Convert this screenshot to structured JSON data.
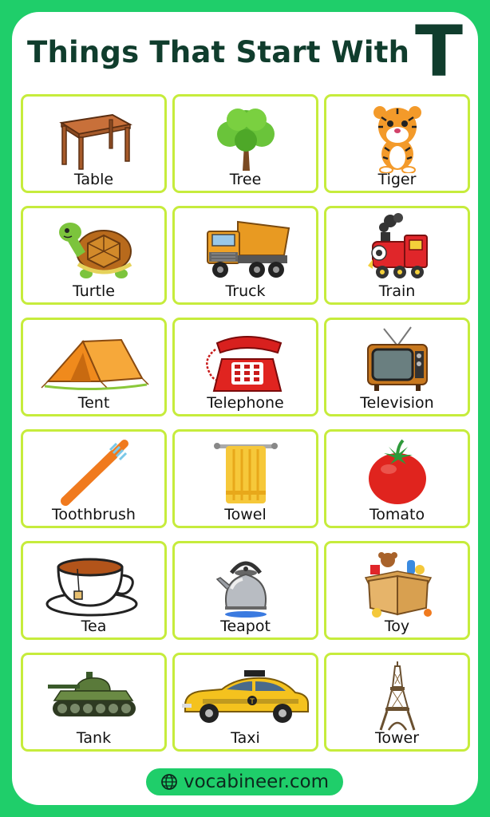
{
  "header": {
    "title": "Things That Start With",
    "letter": "T"
  },
  "cards": [
    {
      "label": "Table",
      "icon": "table-icon"
    },
    {
      "label": "Tree",
      "icon": "tree-icon"
    },
    {
      "label": "Tiger",
      "icon": "tiger-icon"
    },
    {
      "label": "Turtle",
      "icon": "turtle-icon"
    },
    {
      "label": "Truck",
      "icon": "truck-icon"
    },
    {
      "label": "Train",
      "icon": "train-icon"
    },
    {
      "label": "Tent",
      "icon": "tent-icon"
    },
    {
      "label": "Telephone",
      "icon": "telephone-icon"
    },
    {
      "label": "Television",
      "icon": "television-icon"
    },
    {
      "label": "Toothbrush",
      "icon": "toothbrush-icon"
    },
    {
      "label": "Towel",
      "icon": "towel-icon"
    },
    {
      "label": "Tomato",
      "icon": "tomato-icon"
    },
    {
      "label": "Tea",
      "icon": "tea-icon"
    },
    {
      "label": "Teapot",
      "icon": "teapot-icon"
    },
    {
      "label": "Toy",
      "icon": "toy-icon"
    },
    {
      "label": "Tank",
      "icon": "tank-icon"
    },
    {
      "label": "Taxi",
      "icon": "taxi-icon"
    },
    {
      "label": "Tower",
      "icon": "tower-icon"
    }
  ],
  "footer": {
    "site": "vocabineer.com",
    "icon": "globe-icon"
  },
  "colors": {
    "background": "#1fce6a",
    "card_border": "#c6ec3c",
    "title": "#103d2d"
  }
}
